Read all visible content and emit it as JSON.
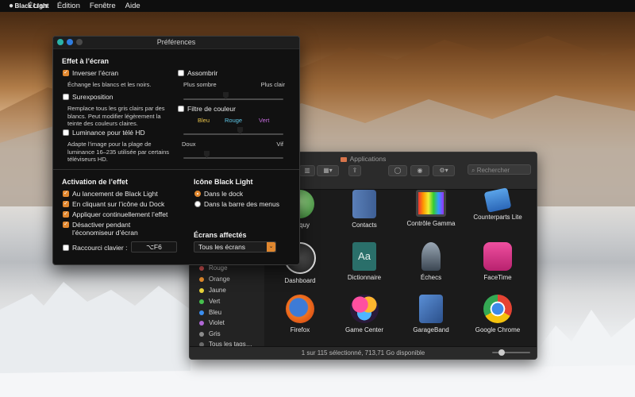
{
  "menubar": {
    "apple": "",
    "app_name": "Black Light",
    "items": [
      "Écran",
      "Édition",
      "Fenêtre",
      "Aide"
    ]
  },
  "prefs": {
    "title": "Préférences",
    "effect_section": "Effet à l’écran",
    "invert_label": "Inverser l’écran",
    "invert_desc": "Échange les blancs et les noirs.",
    "overexposure_label": "Surexposition",
    "overexposure_desc": "Remplace tous les gris clairs par des blancs. Peut modifier légèrement la teinte des couleurs claires.",
    "hd_label": "Luminance pour télé HD",
    "hd_desc": "Adapte l’image pour la plage de luminance 16–235 utilisée par certains téléviseurs HD.",
    "darken_label": "Assombrir",
    "darker_label": "Plus sombre",
    "lighter_label": "Plus clair",
    "color_filter_label": "Filtre de couleur",
    "blue_label": "Bleu",
    "red_label": "Rouge",
    "green_label": "Vert",
    "soft_label": "Doux",
    "bright_label": "Vif",
    "activation_section": "Activation de l’effet",
    "activation_items": [
      "Au lancement de Black Light",
      "En cliquant sur l’icône du Dock",
      "Appliquer continuellement l’effet",
      "Désactiver pendant l’économiseur d’écran"
    ],
    "shortcut_label": "Raccourci clavier :",
    "shortcut_value": "⌥F6",
    "icon_section": "Icône Black Light",
    "icon_options": [
      "Dans le dock",
      "Dans la barre des menus"
    ],
    "screens_section": "Écrans affectés",
    "screens_value": "Tous les écrans",
    "accent": "#e0872f"
  },
  "finder": {
    "title": "Applications",
    "search_placeholder": "Rechercher",
    "tags": [
      {
        "label": "Rouge",
        "color": "#e85b5b"
      },
      {
        "label": "Orange",
        "color": "#f0922e"
      },
      {
        "label": "Jaune",
        "color": "#e8d23a"
      },
      {
        "label": "Vert",
        "color": "#46c04e"
      },
      {
        "label": "Bleu",
        "color": "#3a8ef0"
      },
      {
        "label": "Violet",
        "color": "#b067d6"
      },
      {
        "label": "Gris",
        "color": "#8c8c8c"
      },
      {
        "label": "Tous les tags…",
        "color": "#6a6a6a"
      }
    ],
    "apps": [
      "...oquy",
      "Contacts",
      "Contrôle Gamma",
      "Counterparts Lite",
      "Dashboard",
      "Dictionnaire",
      "Échecs",
      "FaceTime",
      "Firefox",
      "Game Center",
      "GarageBand",
      "Google Chrome"
    ],
    "status": "1 sur 115 sélectionné, 713,71 Go disponible"
  }
}
